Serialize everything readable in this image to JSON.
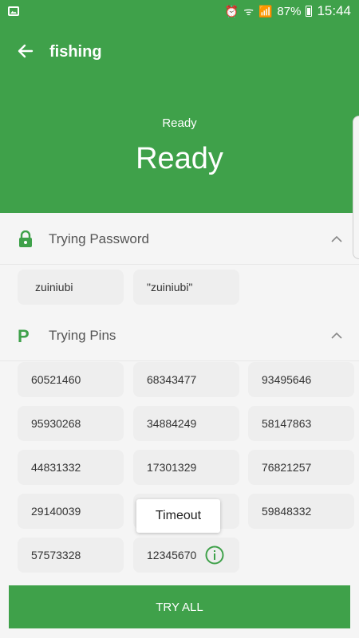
{
  "status_bar": {
    "battery": "87%",
    "time": "15:44"
  },
  "header": {
    "title": "fishing",
    "subtitle": "Ready",
    "status": "Ready"
  },
  "password_section": {
    "title": "Trying Password",
    "items": [
      "zuiniubi",
      "\"zuiniubi\""
    ]
  },
  "pins_section": {
    "title": "Trying Pins",
    "items": [
      "60521460",
      "68343477",
      "93495646",
      "95930268",
      "34884249",
      "58147863",
      "44831332",
      "17301329",
      "76821257",
      "29140039",
      "",
      "59848332",
      "57573328",
      "12345670"
    ]
  },
  "tooltip": {
    "text": "Timeout"
  },
  "action": {
    "label": "TRY ALL"
  },
  "colors": {
    "primary": "#3fa14a",
    "chip": "#eeeeee"
  }
}
